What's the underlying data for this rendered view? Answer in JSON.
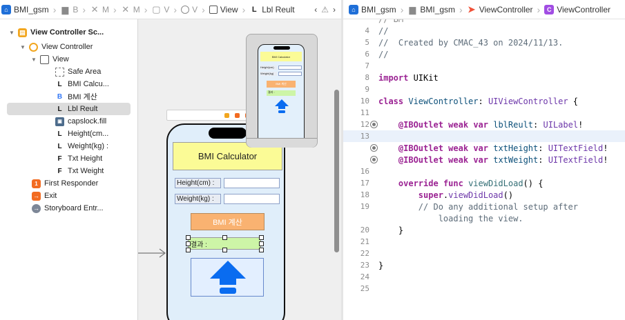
{
  "left_jumpbar": {
    "items": [
      {
        "icon": "app-icon",
        "label": "BMI_gsm"
      },
      {
        "icon": "folder-icon",
        "label": "B"
      },
      {
        "icon": "x-icon",
        "label": "M"
      },
      {
        "icon": "x-icon",
        "label": "M"
      },
      {
        "icon": "x-icon",
        "label": "V"
      },
      {
        "icon": "vc-icon",
        "label": "V"
      },
      {
        "icon": "view-icon",
        "label": "View"
      },
      {
        "icon": "label-icon",
        "label": "Lbl Reult"
      }
    ],
    "lbl_prefix": "L"
  },
  "right_jumpbar": {
    "items": [
      {
        "icon": "app-icon",
        "label": "BMI_gsm"
      },
      {
        "icon": "folder-icon",
        "label": "BMI_gsm"
      },
      {
        "icon": "swift-icon",
        "label": "ViewController"
      },
      {
        "icon": "class-icon",
        "label": "ViewController"
      }
    ],
    "class_prefix": "C"
  },
  "outline": {
    "scene": "View Controller Sc...",
    "view_controller": "View Controller",
    "view": "View",
    "children": [
      {
        "kind": "safe",
        "label": "Safe Area",
        "glyph": ""
      },
      {
        "kind": "L",
        "label": "BMI Calcu...",
        "glyph": "L"
      },
      {
        "kind": "B",
        "label": "BMI 계산",
        "glyph": "B"
      },
      {
        "kind": "L",
        "label": "Lbl Reult",
        "glyph": "L",
        "selected": true
      },
      {
        "kind": "img",
        "label": "capslock.fill",
        "glyph": "▣"
      },
      {
        "kind": "L",
        "label": "Height(cm...",
        "glyph": "L"
      },
      {
        "kind": "L",
        "label": "Weight(kg) :",
        "glyph": "L"
      },
      {
        "kind": "F",
        "label": "Txt Height",
        "glyph": "F"
      },
      {
        "kind": "F",
        "label": "Txt Weight",
        "glyph": "F"
      }
    ],
    "first_responder": "First Responder",
    "first_responder_glyph": "1",
    "exit": "Exit",
    "exit_glyph": "→",
    "storyboard_entry": "Storyboard Entr..."
  },
  "canvas": {
    "title": "BMI Calculator",
    "height_label": "Height(cm) :",
    "weight_label": "Weight(kg) :",
    "button_label": "BMI 계산",
    "result_label": "결과 :",
    "mini_title": "BMI Calculator",
    "mini_height": "Height(cm)",
    "mini_weight": "Weight(kg)",
    "mini_button": "BMI 계산",
    "mini_result": "결과 :"
  },
  "code": {
    "lines": [
      {
        "n": "4",
        "seg": [
          {
            "c": "c",
            "t": "//"
          }
        ]
      },
      {
        "n": "5",
        "seg": [
          {
            "c": "c",
            "t": "//  Created by CMAC_43 on 2024/11/13."
          }
        ]
      },
      {
        "n": "6",
        "seg": [
          {
            "c": "c",
            "t": "//"
          }
        ]
      },
      {
        "n": "7",
        "seg": []
      },
      {
        "n": "8",
        "seg": [
          {
            "c": "k",
            "t": "import"
          },
          {
            "c": "p",
            "t": " UIKit"
          }
        ]
      },
      {
        "n": "9",
        "seg": []
      },
      {
        "n": "10",
        "seg": [
          {
            "c": "k",
            "t": "class"
          },
          {
            "c": "t",
            "t": " ViewController"
          },
          {
            "c": "p",
            "t": ": "
          },
          {
            "c": "tp",
            "t": "UIViewController"
          },
          {
            "c": "p",
            "t": " {"
          }
        ]
      },
      {
        "n": "11",
        "seg": []
      },
      {
        "n": "12",
        "conn": true,
        "seg": [
          {
            "c": "p",
            "t": "    "
          },
          {
            "c": "k",
            "t": "@IBOutlet"
          },
          {
            "c": "p",
            "t": " "
          },
          {
            "c": "k",
            "t": "weak"
          },
          {
            "c": "p",
            "t": " "
          },
          {
            "c": "k",
            "t": "var"
          },
          {
            "c": "t",
            "t": " lblReult"
          },
          {
            "c": "p",
            "t": ": "
          },
          {
            "c": "tp",
            "t": "UILabel"
          },
          {
            "c": "p",
            "t": "!"
          }
        ]
      },
      {
        "n": "13",
        "cur": true,
        "seg": []
      },
      {
        "n": "",
        "conn": true,
        "seg": [
          {
            "c": "p",
            "t": "    "
          },
          {
            "c": "k",
            "t": "@IBOutlet"
          },
          {
            "c": "p",
            "t": " "
          },
          {
            "c": "k",
            "t": "weak"
          },
          {
            "c": "p",
            "t": " "
          },
          {
            "c": "k",
            "t": "var"
          },
          {
            "c": "t",
            "t": " txtHeight"
          },
          {
            "c": "p",
            "t": ": "
          },
          {
            "c": "tp",
            "t": "UITextField"
          },
          {
            "c": "p",
            "t": "!"
          }
        ]
      },
      {
        "n": "",
        "conn": true,
        "seg": [
          {
            "c": "p",
            "t": "    "
          },
          {
            "c": "k",
            "t": "@IBOutlet"
          },
          {
            "c": "p",
            "t": " "
          },
          {
            "c": "k",
            "t": "weak"
          },
          {
            "c": "p",
            "t": " "
          },
          {
            "c": "k",
            "t": "var"
          },
          {
            "c": "t",
            "t": " txtWeight"
          },
          {
            "c": "p",
            "t": ": "
          },
          {
            "c": "tp",
            "t": "UITextField"
          },
          {
            "c": "p",
            "t": "!"
          }
        ]
      },
      {
        "n": "16",
        "seg": []
      },
      {
        "n": "17",
        "seg": [
          {
            "c": "p",
            "t": "    "
          },
          {
            "c": "k",
            "t": "override"
          },
          {
            "c": "p",
            "t": " "
          },
          {
            "c": "k",
            "t": "func"
          },
          {
            "c": "m",
            "t": " viewDidLoad"
          },
          {
            "c": "p",
            "t": "() {"
          }
        ]
      },
      {
        "n": "18",
        "seg": [
          {
            "c": "p",
            "t": "        "
          },
          {
            "c": "k",
            "t": "super"
          },
          {
            "c": "p",
            "t": "."
          },
          {
            "c": "tp",
            "t": "viewDidLoad"
          },
          {
            "c": "p",
            "t": "()"
          }
        ]
      },
      {
        "n": "19",
        "seg": [
          {
            "c": "p",
            "t": "        "
          },
          {
            "c": "c",
            "t": "// Do any additional setup after"
          }
        ]
      },
      {
        "n": "",
        "seg": [
          {
            "c": "c",
            "t": "            loading the view."
          }
        ]
      },
      {
        "n": "20",
        "seg": [
          {
            "c": "p",
            "t": "    }"
          }
        ]
      },
      {
        "n": "21",
        "seg": []
      },
      {
        "n": "22",
        "seg": []
      },
      {
        "n": "23",
        "seg": [
          {
            "c": "p",
            "t": "}"
          }
        ]
      },
      {
        "n": "24",
        "seg": []
      },
      {
        "n": "25",
        "seg": []
      }
    ],
    "clipped_top": "//  BM"
  },
  "colors": {
    "selection": "#dcdcdc",
    "title_yellow": "#fbfb96",
    "button_orange": "#f9b271",
    "result_green": "#cdf5a7",
    "arrow_blue": "#0a6cf0"
  }
}
